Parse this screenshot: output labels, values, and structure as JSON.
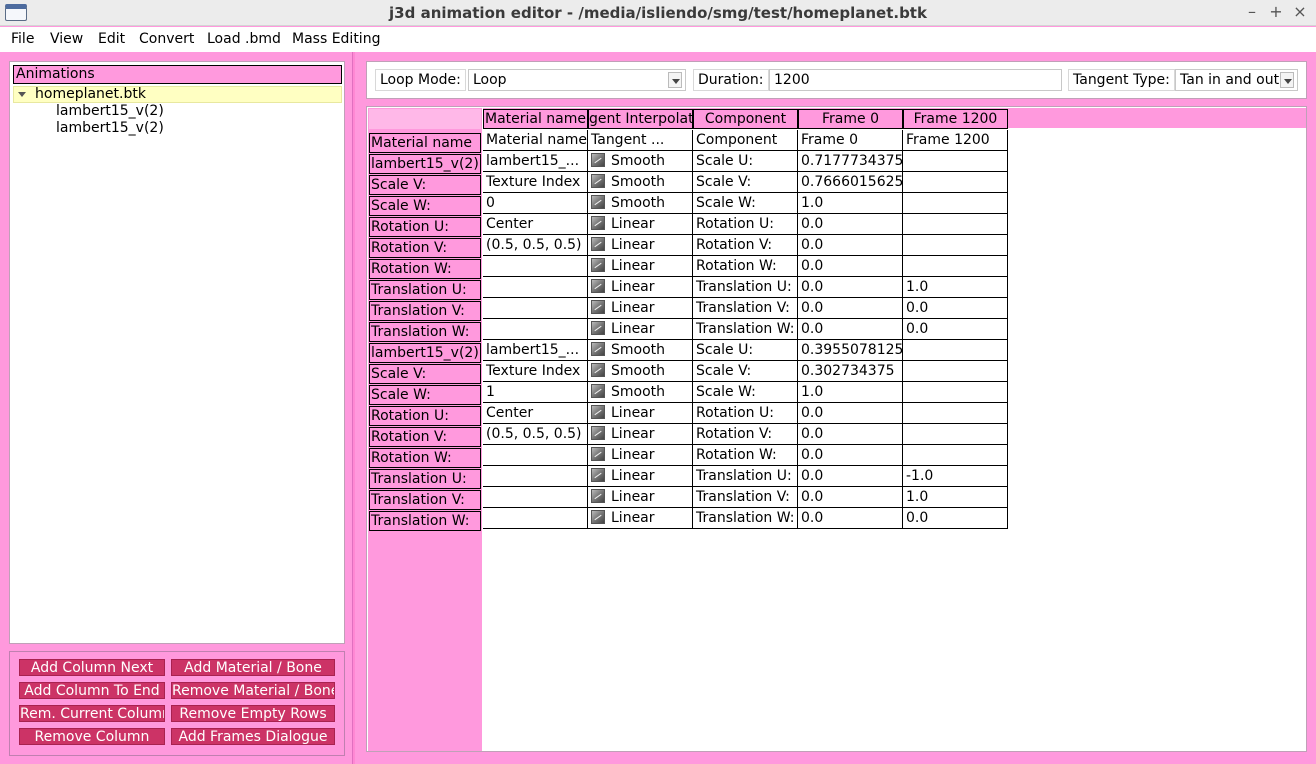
{
  "window": {
    "title": "j3d animation editor - /media/isliendo/smg/test/homeplanet.btk"
  },
  "menu": [
    "File",
    "View",
    "Edit",
    "Convert",
    "Load .bmd",
    "Mass Editing"
  ],
  "tree": {
    "header": "Animations",
    "root": "homeplanet.btk",
    "children": [
      "lambert15_v(2)",
      "lambert15_v(2)"
    ]
  },
  "buttons": [
    "Add Column Next",
    "Add Material / Bone",
    "Add Column To End",
    "Remove Material / Bone",
    "Rem. Current Column",
    "Remove Empty Rows",
    "Remove Column",
    "Add Frames Dialogue"
  ],
  "controls": {
    "loop_mode_label": "Loop Mode:",
    "loop_mode_value": "Loop",
    "duration_label": "Duration:",
    "duration_value": "1200",
    "tangent_label": "Tangent Type:",
    "tangent_value": "Tan in and out"
  },
  "table": {
    "column_headers": [
      "Material name",
      "gent Interpolat",
      "Component",
      "Frame 0",
      "Frame 1200"
    ],
    "header_row": [
      "Material name",
      "Tangent ...",
      "Component",
      "Frame 0",
      "Frame 1200"
    ],
    "header_row_label": "Material name",
    "row_labels": [
      "lambert15_v(2)",
      "Scale V:",
      "Scale W:",
      "Rotation U:",
      "Rotation V:",
      "Rotation W:",
      "Translation U:",
      "Translation V:",
      "Translation W:",
      "lambert15_v(2)",
      "Scale V:",
      "Scale W:",
      "Rotation U:",
      "Rotation V:",
      "Rotation W:",
      "Translation U:",
      "Translation V:",
      "Translation W:"
    ],
    "rows": [
      [
        "lambert15_...",
        "Smooth",
        "Scale U:",
        "0.7177734375",
        ""
      ],
      [
        "Texture Index",
        "Smooth",
        "Scale V:",
        "0.7666015625",
        ""
      ],
      [
        "0",
        "Smooth",
        "Scale W:",
        "1.0",
        ""
      ],
      [
        "Center",
        "Linear",
        "Rotation U:",
        "0.0",
        ""
      ],
      [
        "(0.5, 0.5, 0.5)",
        "Linear",
        "Rotation V:",
        "0.0",
        ""
      ],
      [
        "",
        "Linear",
        "Rotation W:",
        "0.0",
        ""
      ],
      [
        "",
        "Linear",
        "Translation U:",
        "0.0",
        "1.0"
      ],
      [
        "",
        "Linear",
        "Translation V:",
        "0.0",
        "0.0"
      ],
      [
        "",
        "Linear",
        "Translation W:",
        "0.0",
        "0.0"
      ],
      [
        "lambert15_...",
        "Smooth",
        "Scale U:",
        "0.3955078125",
        ""
      ],
      [
        "Texture Index",
        "Smooth",
        "Scale V:",
        "0.302734375",
        ""
      ],
      [
        "1",
        "Smooth",
        "Scale W:",
        "1.0",
        ""
      ],
      [
        "Center",
        "Linear",
        "Rotation U:",
        "0.0",
        ""
      ],
      [
        "(0.5, 0.5, 0.5)",
        "Linear",
        "Rotation V:",
        "0.0",
        ""
      ],
      [
        "",
        "Linear",
        "Rotation W:",
        "0.0",
        ""
      ],
      [
        "",
        "Linear",
        "Translation U:",
        "0.0",
        "-1.0"
      ],
      [
        "",
        "Linear",
        "Translation V:",
        "0.0",
        "1.0"
      ],
      [
        "",
        "Linear",
        "Translation W:",
        "0.0",
        "0.0"
      ]
    ]
  },
  "colors": {
    "accent": "#ff99dd",
    "button": "#cc3366",
    "selection": "#ffffc2"
  }
}
